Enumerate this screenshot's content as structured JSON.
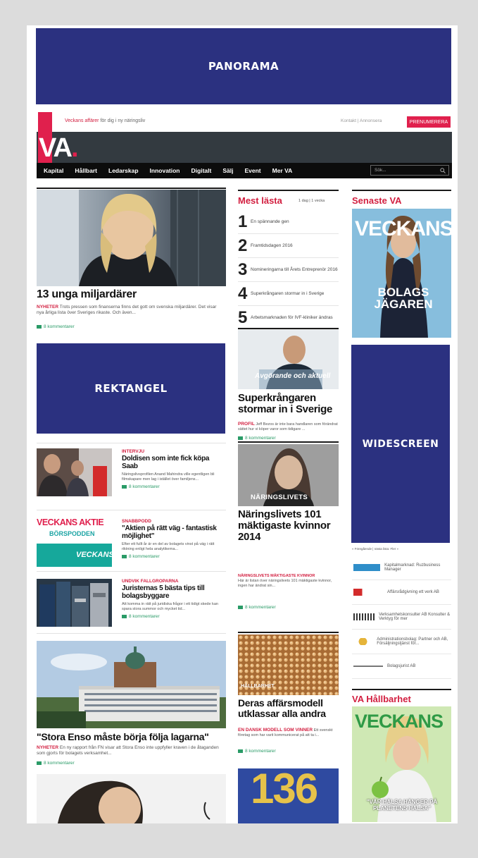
{
  "ads": {
    "panorama": "PANORAMA",
    "rektangel": "REKTANGEL",
    "widescreen": "WIDESCREEN"
  },
  "header": {
    "tagline_prefix": "Veckans affärer",
    "tagline_rest": " för dig i ny näringsliv",
    "links": "Kontakt  |  Annonsera",
    "button": "PRENUMERERA",
    "logo": "VA",
    "search_placeholder": "Sök..."
  },
  "nav": [
    "Kapital",
    "Hållbart",
    "Ledarskap",
    "Innovation",
    "Digitalt",
    "Sälj",
    "Event",
    "Mer VA"
  ],
  "main_story": {
    "headline": "13 unga miljardärer",
    "tag": "NYHETER",
    "teaser": "Trots pressen som finanserna finns det gott om svenska miljardärer. Det visar nya årliga lista över Sveriges rikaste. Och även...",
    "meta": "8 kommentarer"
  },
  "small_stories": [
    {
      "tag": "INTERVJU",
      "headline": "Doldisen som inte fick köpa Saab",
      "teaser": "Näringslivsprofilen Anand Mahindra ville egentligen bli filmskapare men lag i istället över familjens...",
      "meta": "8 kommentarer"
    },
    {
      "tag": "SNABBPODD",
      "headline": "\"Aktien på rätt väg - fantastisk möjlighet\"",
      "teaser": "Efter ett fullt år är en del av bolagets vinst på väg i rätt riktning enligt hela analytikerna...",
      "meta": "8 kommentarer"
    },
    {
      "tag": "UNDVIK FALLGROPARNA",
      "headline": "Juristernas 5 bästa tips till bolagsbyggare",
      "teaser": "Att komma in rätt på juridiska frågor i ett tidigt skede kan spara stora summor och mycket tid...",
      "meta": "8 kommentarer"
    }
  ],
  "veckans_aktie": {
    "line1": "VECKANS AKTIE",
    "line2": "BÖRSPODDEN",
    "line3": "VECKANS"
  },
  "bottom_story": {
    "headline": "\"Stora Enso måste börja följa lagarna\"",
    "tag": "NYHETER",
    "teaser": "En ny rapport från FN visar att Stora Enso inte uppfyller kraven i de åtaganden som gjorts för bolagets verksamhet...",
    "meta": "8 kommentarer"
  },
  "mest_lasta": {
    "title": "Mest lästa",
    "tabs": "1 dag  |  1 vecka",
    "items": [
      "En spännande gen",
      "Framtidsdagen 2016",
      "Nomineringarna till Årets Entreprenör 2016",
      "Superkrångaren stormar in i Sverige",
      "Arbetsmarknaden för IVF-kliniker ändras"
    ]
  },
  "middle_stories": [
    {
      "overlay": "Avgörande och aktuell",
      "headline": "Superkrångaren stormar in i Sverige",
      "tag": "PROFIL",
      "teaser": "Jeff Bezos är inte bara handlaren som förändrat sättet hur vi köper varor som tidigare ...",
      "meta": "8 kommentarer"
    },
    {
      "overlay": "NÄRINGSLIVETS",
      "headline": "Näringslivets 101 mäktigaste kvinnor 2014",
      "tag": "NÄRINGSLIVETS MÄKTIGASTE KVINNOR",
      "teaser": "Här är listan över näringslivets 101 mäktigaste kvinnor, ingen har ändrat sin...",
      "meta": "8 kommentarer"
    },
    {
      "overlay": "HÅLLBARHET",
      "headline": "Deras affärsmodell utklassar alla andra",
      "tag": "EN DANSK MODELL SOM VINNER",
      "teaser": "Ett svenskt företag som har varit kommunicerat på att ta i...",
      "meta": "8 kommentarer"
    }
  ],
  "big_number": "136",
  "senaste_va": {
    "title": "Senaste VA",
    "magazine": "VECKANS",
    "cover_line": "BOLAGS JÄGAREN"
  },
  "list_widget": {
    "title": "« Föregående | nästa lista: Fler »",
    "rows": [
      "Kapitalmarknad: Ruzbusiness Manager",
      "Affärsrådgivning ett verk AB",
      "Verksamhetskonsulter AB Konsulter & Verktyg för mer",
      "Administrationsbolag: Partner och AB, Försäljningstjänst för...",
      "Bolagsjurist AB"
    ]
  },
  "va_hallbarhet": {
    "title": "VA Hållbarhet",
    "magazine": "VECKANS",
    "cover_line": "\"VÅR HÄLSA HÄNGER PÅ PLANETENS HÄLSA\""
  }
}
